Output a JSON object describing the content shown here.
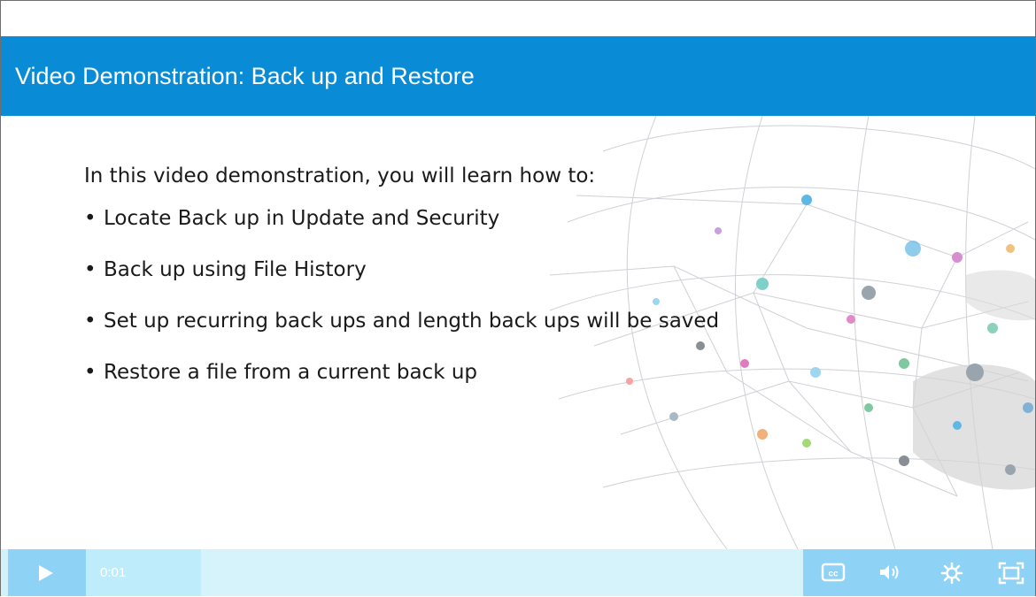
{
  "slide": {
    "title": "Video Demonstration: Back up and Restore",
    "intro": "In this video demonstration, you will learn how to:",
    "bullet_marker": "•",
    "bullets": [
      "Locate Back up in Update and Security",
      "Back up using File History",
      "Set up recurring back ups and length back ups will be saved",
      "Restore a file from a current back up"
    ]
  },
  "player": {
    "current_time": "0:01",
    "progress_fraction": 0.16,
    "icons": [
      "play-icon",
      "closed-captions-icon",
      "volume-icon",
      "settings-gear-icon",
      "fullscreen-icon"
    ],
    "cc_label": "cc"
  },
  "colors": {
    "title_bar": "#0a8bd6",
    "controls_bg": "#d3f1fb",
    "controls_accent": "#8ed3f5",
    "text": "#1a1a1a"
  }
}
